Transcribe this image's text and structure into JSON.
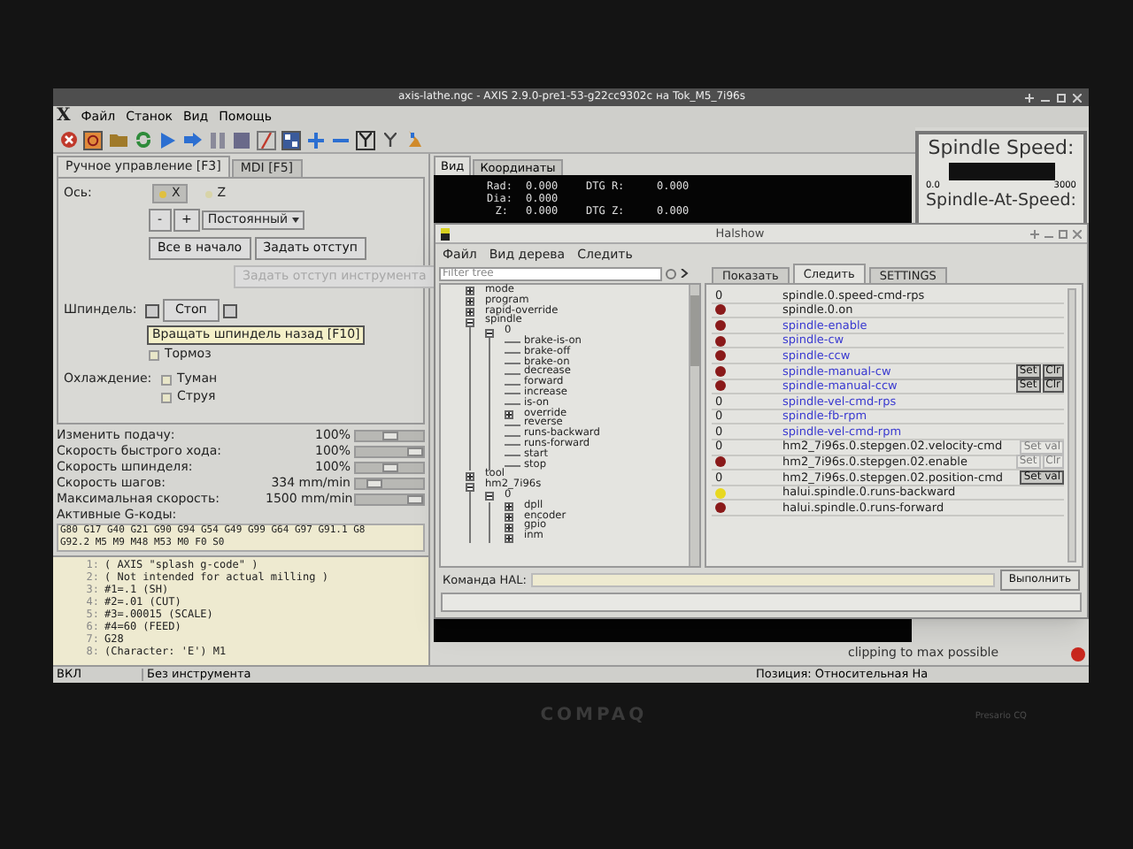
{
  "axis": {
    "title": "axis-lathe.ngc - AXIS 2.9.0-pre1-53-g22cc9302c на Tok_M5_7i96s",
    "logo": "X",
    "menu": [
      "Файл",
      "Станок",
      "Вид",
      "Помощь"
    ],
    "tabs": [
      {
        "label": "Ручное управление [F3]",
        "selected": true
      },
      {
        "label": "MDI [F5]",
        "selected": false
      }
    ],
    "axis_label": "Ось:",
    "axes": [
      {
        "label": "X",
        "selected": true
      },
      {
        "label": "Z",
        "selected": false
      }
    ],
    "jog_minus": "-",
    "jog_plus": "+",
    "jog_mode": "Постоянный",
    "home_all": "Все в начало",
    "touch_off": "Задать отступ",
    "tool_touch_off": {
      "label": "Задать отступ инструмента",
      "disabled": true
    },
    "spindle_label": "Шпиндель:",
    "spindle_stop": "Стоп",
    "tooltip": "Вращать шпиндель назад [F10]",
    "brake": {
      "label": "Тормоз",
      "checked": false
    },
    "coolant_label": "Охлаждение:",
    "coolant": [
      {
        "label": "Туман",
        "checked": false
      },
      {
        "label": "Струя",
        "checked": false
      }
    ],
    "sliders": [
      {
        "label": "Изменить подачу:",
        "reading": "100%",
        "level": 0.5
      },
      {
        "label": "Скорость быстрого хода:",
        "reading": "100%",
        "level": 1
      },
      {
        "label": "Скорость шпинделя:",
        "reading": "100%",
        "level": 0.5
      },
      {
        "label": "Скорость шагов:",
        "reading": "334 mm/min",
        "level": 0.2
      },
      {
        "label": "Максимальная скорость:",
        "reading": "1500 mm/min",
        "level": 1
      }
    ],
    "gcodes_label": "Активные G-коды:",
    "gcodes": [
      "G80 G17 G40 G21 G90 G94 G54 G49 G99 G64 G97 G91.1 G8",
      "G92.2 M5 M9 M48 M53 M0 F0 S0"
    ],
    "program": [
      {
        "num": "1:",
        "text": "( AXIS \"splash g-code\" )"
      },
      {
        "num": "2:",
        "text": "( Not intended for actual milling )"
      },
      {
        "num": "3:",
        "text": "#1=.1 (SH)"
      },
      {
        "num": "4:",
        "text": "#2=.01 (CUT)"
      },
      {
        "num": "5:",
        "text": "#3=.00015 (SCALE)"
      },
      {
        "num": "6:",
        "text": "#4=60 (FEED)"
      },
      {
        "num": "7:",
        "text": "G28"
      },
      {
        "num": "8:",
        "text": "(Character: 'E') M1"
      }
    ],
    "view_tabs": [
      {
        "label": "Вид",
        "selected": true
      },
      {
        "label": "Координаты",
        "selected": false
      }
    ],
    "dro": [
      [
        "Rad:",
        "0.000",
        "DTG R:",
        "0.000"
      ],
      [
        "Dia:",
        "0.000"
      ],
      [
        "Z:",
        "0.000",
        "DTG Z:",
        "0.000"
      ]
    ],
    "message": "clipping to max possible",
    "status": [
      "ВКЛ",
      "Без инструмента"
    ],
    "position": "Позиция: Относительная На"
  },
  "spindle_panel": {
    "title": "Spindle Speed:",
    "min": "0.0",
    "max": "3000",
    "title2": "Spindle-At-Speed:"
  },
  "halshow": {
    "title": "Halshow",
    "menu": [
      "Файл",
      "Вид дерева",
      "Следить"
    ],
    "filter_placeholder": "Filter tree",
    "tree": [
      {
        "label": "mode",
        "expanded": false
      },
      {
        "label": "program",
        "expanded": false
      },
      {
        "label": "rapid-override",
        "expanded": false
      },
      {
        "label": "spindle",
        "expanded": true,
        "children": [
          {
            "label": "0",
            "expanded": true,
            "children": [
              {
                "label": "brake-is-on"
              },
              {
                "label": "brake-off"
              },
              {
                "label": "brake-on"
              },
              {
                "label": "decrease"
              },
              {
                "label": "forward"
              },
              {
                "label": "increase"
              },
              {
                "label": "is-on"
              },
              {
                "label": "override",
                "expanded": false
              },
              {
                "label": "reverse"
              },
              {
                "label": "runs-backward"
              },
              {
                "label": "runs-forward"
              },
              {
                "label": "start"
              },
              {
                "label": "stop"
              }
            ]
          }
        ]
      },
      {
        "label": "tool",
        "expanded": false
      },
      {
        "label": "hm2_7i96s",
        "expanded": true,
        "children": [
          {
            "label": "0",
            "expanded": true,
            "children": [
              {
                "label": "dpll",
                "expanded": false
              },
              {
                "label": "encoder",
                "expanded": false
              },
              {
                "label": "gpio",
                "expanded": false
              },
              {
                "label": "inm",
                "expanded": false
              }
            ]
          }
        ]
      }
    ],
    "tabs": [
      {
        "label": "Показать",
        "selected": false
      },
      {
        "label": "Следить",
        "selected": true
      },
      {
        "label": "SETTINGS",
        "selected": false
      }
    ],
    "watch": [
      {
        "kind": "value",
        "value": "0",
        "signal": false,
        "name": "spindle.0.speed-cmd-rps"
      },
      {
        "kind": "bit",
        "on": false,
        "signal": false,
        "name": "spindle.0.on"
      },
      {
        "kind": "bit",
        "on": false,
        "signal": true,
        "name": "spindle-enable"
      },
      {
        "kind": "bit",
        "on": false,
        "signal": true,
        "name": "spindle-cw"
      },
      {
        "kind": "bit",
        "on": false,
        "signal": true,
        "name": "spindle-ccw"
      },
      {
        "kind": "bit",
        "on": false,
        "signal": true,
        "name": "spindle-manual-cw",
        "buttons": [
          {
            "label": "Set",
            "disabled": false
          },
          {
            "label": "Clr",
            "disabled": false
          }
        ]
      },
      {
        "kind": "bit",
        "on": false,
        "signal": true,
        "name": "spindle-manual-ccw",
        "buttons": [
          {
            "label": "Set",
            "disabled": false
          },
          {
            "label": "Clr",
            "disabled": false
          }
        ]
      },
      {
        "kind": "value",
        "value": "0",
        "signal": true,
        "name": "spindle-vel-cmd-rps"
      },
      {
        "kind": "value",
        "value": "0",
        "signal": true,
        "name": "spindle-fb-rpm"
      },
      {
        "kind": "value",
        "value": "0",
        "signal": true,
        "name": "spindle-vel-cmd-rpm"
      },
      {
        "kind": "value",
        "value": "0",
        "signal": false,
        "name": "hm2_7i96s.0.stepgen.02.velocity-cmd",
        "buttons": [
          {
            "label": "Set val",
            "disabled": true
          }
        ]
      },
      {
        "kind": "bit",
        "on": false,
        "signal": false,
        "name": "hm2_7i96s.0.stepgen.02.enable",
        "buttons": [
          {
            "label": "Set",
            "disabled": true
          },
          {
            "label": "Clr",
            "disabled": true
          }
        ]
      },
      {
        "kind": "value",
        "value": "0",
        "signal": false,
        "name": "hm2_7i96s.0.stepgen.02.position-cmd",
        "buttons": [
          {
            "label": "Set val",
            "disabled": false
          }
        ]
      },
      {
        "kind": "bit",
        "on": true,
        "signal": false,
        "name": "halui.spindle.0.runs-backward"
      },
      {
        "kind": "bit",
        "on": false,
        "signal": false,
        "name": "halui.spindle.0.runs-forward"
      }
    ],
    "command_label": "Команда HAL:",
    "execute": "Выполнить"
  },
  "bezel": {
    "brand": "COMPAQ",
    "model": "Presario CQ"
  }
}
